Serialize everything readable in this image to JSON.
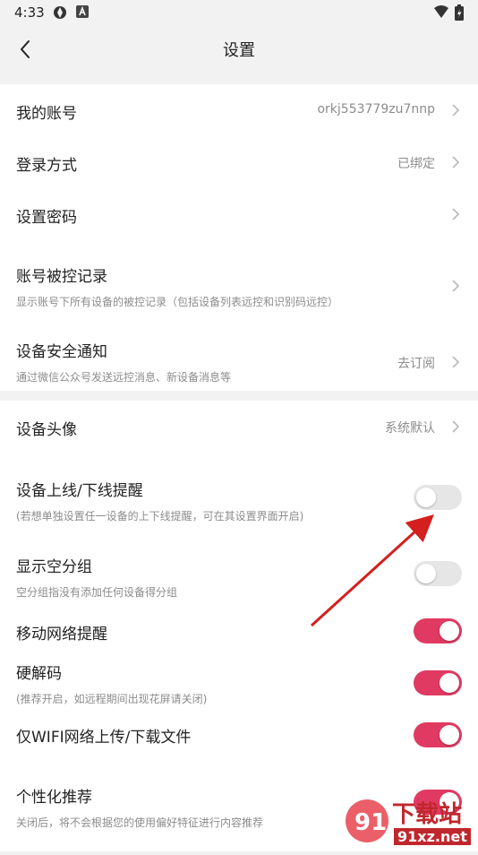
{
  "status": {
    "time": "4:33"
  },
  "header": {
    "title": "设置"
  },
  "account": [
    {
      "label": "我的账号",
      "value": "orkj553779zu7nnp"
    },
    {
      "label": "登录方式",
      "value": "已绑定"
    },
    {
      "label": "设置密码"
    },
    {
      "label": "账号被控记录",
      "sub": "显示账号下所有设备的被控记录（包括设备列表远控和识别码远控）"
    },
    {
      "label": "设备安全通知",
      "sub": "通过微信公众号发送远控消息、新设备消息等",
      "value": "去订阅"
    }
  ],
  "device": {
    "avatar": {
      "label": "设备头像",
      "value": "系统默认"
    },
    "toggles": [
      {
        "label": "设备上线/下线提醒",
        "sub": "(若想单独设置任一设备的上下线提醒，可在其设置界面开启)",
        "on": false
      },
      {
        "label": "显示空分组",
        "sub": "空分组指没有添加任何设备得分组",
        "on": false
      },
      {
        "label": "移动网络提醒",
        "on": true
      },
      {
        "label": "硬解码",
        "sub": "(推荐开启，如远程期间出现花屏请关闭)",
        "on": true
      },
      {
        "label": "仅WIFI网络上传/下载文件",
        "on": true
      },
      {
        "label": "个性化推荐",
        "sub": "关闭后，将不会根据您的使用偏好特征进行内容推荐",
        "on": true
      }
    ]
  },
  "watermark": {
    "text": "下载站",
    "domain": "91xz.net"
  },
  "colors": {
    "accent": "#e03a63",
    "annotation": "#d41f1f"
  }
}
